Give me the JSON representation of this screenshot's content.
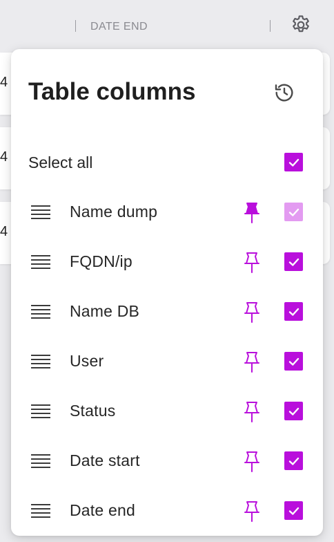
{
  "header": {
    "column_label": "DATE END",
    "settings_icon": "gear-icon"
  },
  "background_rows": [
    "4",
    "4",
    "4"
  ],
  "panel": {
    "title": "Table columns",
    "history_icon": "history-icon",
    "select_all": {
      "label": "Select all",
      "checked": true
    },
    "columns": [
      {
        "label": "Name dump",
        "pinned": true,
        "checked": true,
        "disabled": true
      },
      {
        "label": "FQDN/ip",
        "pinned": false,
        "checked": true,
        "disabled": false
      },
      {
        "label": "Name DB",
        "pinned": false,
        "checked": true,
        "disabled": false
      },
      {
        "label": "User",
        "pinned": false,
        "checked": true,
        "disabled": false
      },
      {
        "label": "Status",
        "pinned": false,
        "checked": true,
        "disabled": false
      },
      {
        "label": "Date start",
        "pinned": false,
        "checked": true,
        "disabled": false
      },
      {
        "label": "Date end",
        "pinned": false,
        "checked": true,
        "disabled": false
      }
    ]
  },
  "colors": {
    "accent": "#b90fdc",
    "accent_disabled": "#e39bf1"
  }
}
